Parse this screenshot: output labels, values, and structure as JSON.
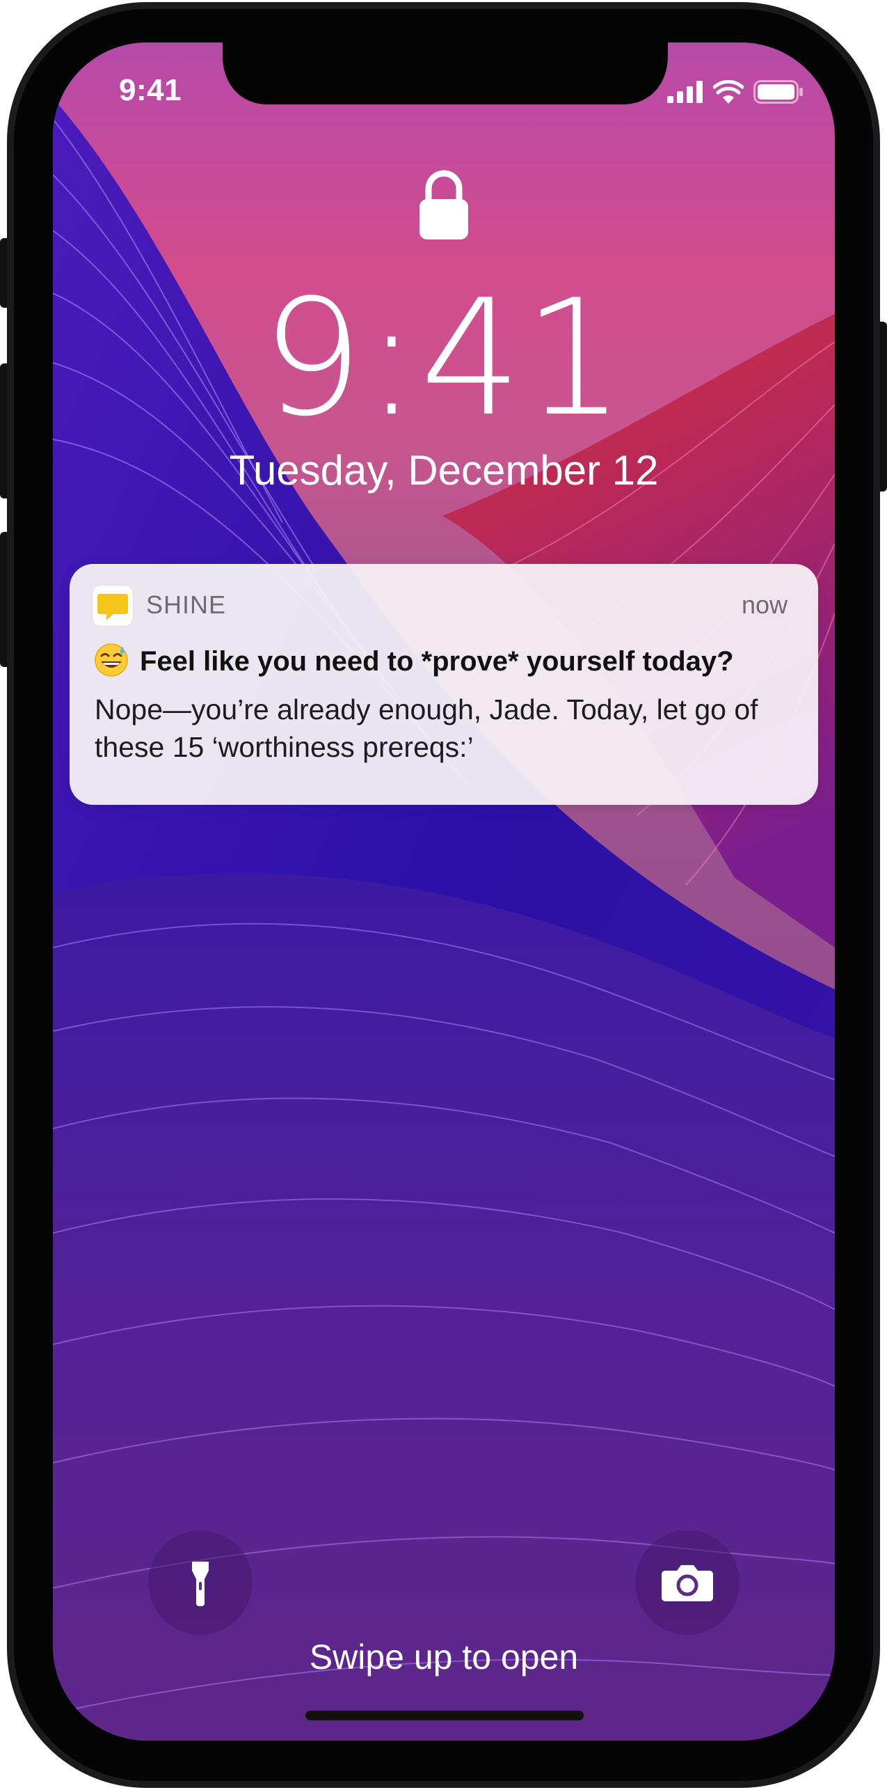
{
  "status_bar": {
    "time": "9:41",
    "icons": [
      "signal-icon",
      "wifi-icon",
      "battery-icon"
    ]
  },
  "lock_screen": {
    "lock_icon": "lock-icon",
    "time": "9:41",
    "date": "Tuesday, December 12"
  },
  "notification": {
    "app_icon": "speech-bubble-icon",
    "app_name": "SHINE",
    "timestamp": "now",
    "title_emoji": "grinning-sweat-emoji",
    "title": "Feel like you need to *prove* yourself today?",
    "body": "Nope—you’re already enough, Jade. Today, let go of these 15 ‘worthiness prereqs:’"
  },
  "bottom": {
    "left_button_icon": "flashlight-icon",
    "right_button_icon": "camera-icon",
    "hint": "Swipe up to open"
  },
  "colors": {
    "wallpaper_top": "#C04BA3",
    "wallpaper_magenta": "#D24C8E",
    "wallpaper_red": "#D0333D",
    "wallpaper_blue": "#2A10A6",
    "wallpaper_purple": "#5B2492",
    "app_icon_yellow": "#F5C518"
  }
}
